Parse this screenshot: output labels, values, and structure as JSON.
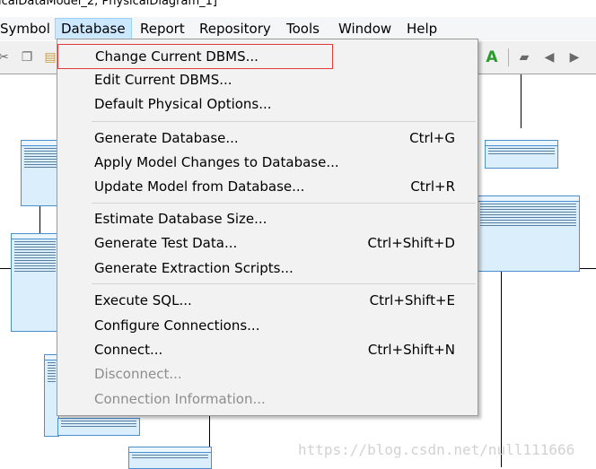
{
  "window": {
    "title": "icalDataModel_2, PhysicalDiagram_1]"
  },
  "menubar": {
    "items": [
      "Symbol",
      "Database",
      "Report",
      "Repository",
      "Tools",
      "Window",
      "Help"
    ],
    "active": "Database"
  },
  "database_menu": {
    "items": [
      {
        "label": "Change Current DBMS...",
        "shortcut": "",
        "enabled": true
      },
      {
        "label": "Edit Current DBMS...",
        "shortcut": "",
        "enabled": true
      },
      {
        "label": "Default Physical Options...",
        "shortcut": "",
        "enabled": true
      },
      {
        "label": "Generate Database...",
        "shortcut": "Ctrl+G",
        "enabled": true
      },
      {
        "label": "Apply Model Changes to Database...",
        "shortcut": "",
        "enabled": true
      },
      {
        "label": "Update Model from Database...",
        "shortcut": "Ctrl+R",
        "enabled": true
      },
      {
        "label": "Estimate Database Size...",
        "shortcut": "",
        "enabled": true
      },
      {
        "label": "Generate Test Data...",
        "shortcut": "Ctrl+Shift+D",
        "enabled": true
      },
      {
        "label": "Generate Extraction Scripts...",
        "shortcut": "",
        "enabled": true
      },
      {
        "label": "Execute SQL...",
        "shortcut": "Ctrl+Shift+E",
        "enabled": true
      },
      {
        "label": "Configure Connections...",
        "shortcut": "",
        "enabled": true
      },
      {
        "label": "Connect...",
        "shortcut": "Ctrl+Shift+N",
        "enabled": true
      },
      {
        "label": "Disconnect...",
        "shortcut": "",
        "enabled": false
      },
      {
        "label": "Connection Information...",
        "shortcut": "",
        "enabled": false
      }
    ]
  },
  "toolbar": {
    "icons": [
      "cut-icon",
      "copy-icon",
      "paste-icon",
      "text-a-icon",
      "folder-icon",
      "arrow-left-icon",
      "arrow-right-icon"
    ]
  },
  "watermark": "https://blog.csdn.net/null111666",
  "colors": {
    "menu_highlight_border": "#e03a3a",
    "menubar_active": "#cce8ff",
    "table_fill": "#dbeefc",
    "table_border": "#4a8fd0"
  }
}
